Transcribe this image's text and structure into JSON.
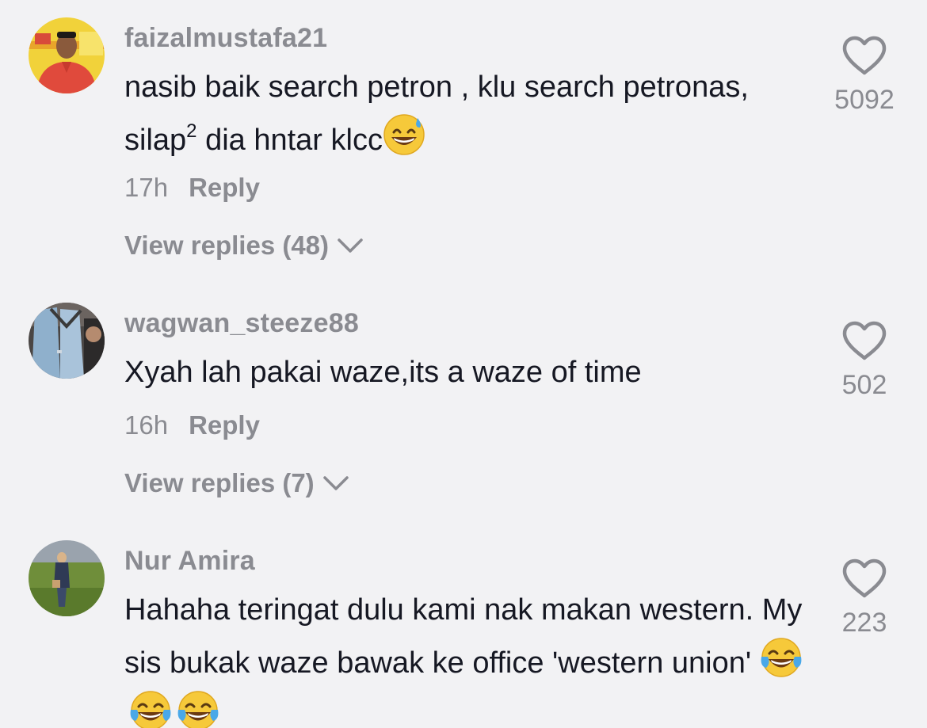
{
  "colors": {
    "background": "#f2f2f4",
    "text_primary": "#161823",
    "text_secondary": "#8a8b91"
  },
  "comments": [
    {
      "username": "faizalmustafa21",
      "text_part1": "nasib baik search petron , klu search petronas, silap",
      "text_sup": "2",
      "text_part2": " dia hntar klcc",
      "emojis": [
        "grinning-sweat-emoji"
      ],
      "time": "17h",
      "reply_label": "Reply",
      "view_replies": "View replies (48)",
      "likes": "5092",
      "avatar_icon": "avatar-man-red-shirt"
    },
    {
      "username": "wagwan_steeze88",
      "text": "Xyah lah pakai waze,its a waze of time",
      "time": "16h",
      "reply_label": "Reply",
      "view_replies": "View replies (7)",
      "likes": "502",
      "avatar_icon": "avatar-denim-jacket"
    },
    {
      "username": "Nur Amira",
      "text": "Hahaha teringat dulu kami nak makan western. My sis bukak waze bawak ke office 'western union' ",
      "emojis": [
        "tears-of-joy-emoji",
        "tears-of-joy-emoji",
        "tears-of-joy-emoji"
      ],
      "likes": "223",
      "avatar_icon": "avatar-woman-field"
    }
  ]
}
